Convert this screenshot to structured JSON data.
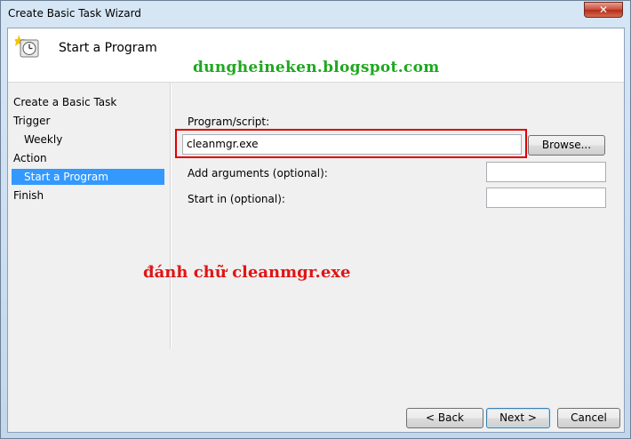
{
  "window": {
    "title": "Create Basic Task Wizard",
    "close_glyph": "✕"
  },
  "header": {
    "title": "Start a Program",
    "icon": "clock-icon"
  },
  "watermark": "dungheineken.blogspot.com",
  "nav": {
    "items": [
      {
        "label": "Create a Basic Task",
        "selected": false
      },
      {
        "label": "Trigger",
        "selected": false
      },
      {
        "label": "Weekly",
        "selected": false
      },
      {
        "label": "Action",
        "selected": false
      },
      {
        "label": "Start a Program",
        "selected": true
      },
      {
        "label": "Finish",
        "selected": false
      }
    ]
  },
  "form": {
    "program_label": "Program/script:",
    "program_value": "cleanmgr.exe",
    "browse_label": "Browse...",
    "arguments_label": "Add arguments (optional):",
    "arguments_value": "",
    "startin_label": "Start in (optional):",
    "startin_value": ""
  },
  "annotation": "đánh chữ cleanmgr.exe",
  "footer": {
    "back_label": "< Back",
    "next_label": "Next >",
    "cancel_label": "Cancel"
  },
  "colors": {
    "selection": "#3399ff",
    "highlight_box": "#e00000",
    "watermark": "#1ea81e",
    "annotation": "#e01515"
  }
}
